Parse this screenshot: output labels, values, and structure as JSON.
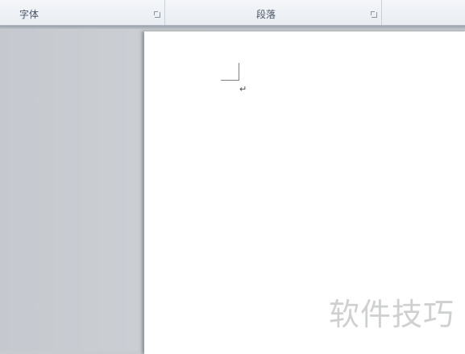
{
  "ribbon": {
    "groups": [
      {
        "label": "字体",
        "launcher_icon": "dialog-launcher-icon"
      },
      {
        "label": "段落",
        "launcher_icon": "dialog-launcher-icon"
      }
    ]
  },
  "document": {
    "paragraph_mark": "↵"
  },
  "watermark": {
    "text": "软件技巧"
  }
}
